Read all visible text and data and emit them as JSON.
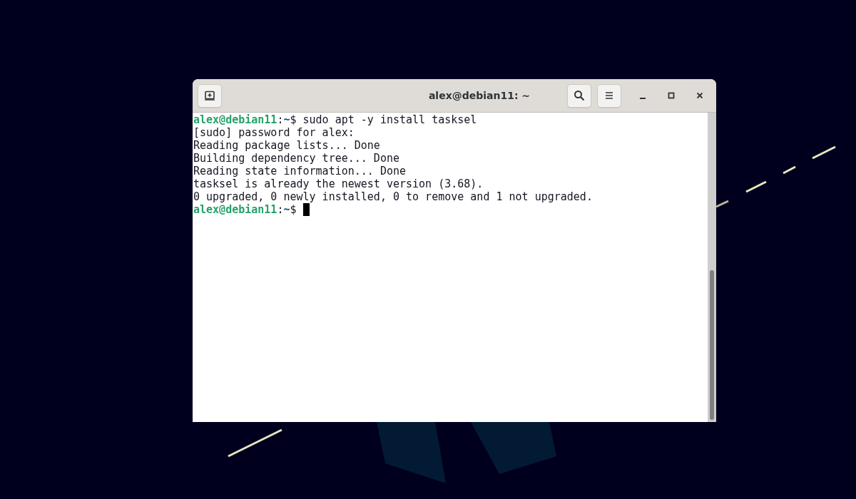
{
  "window": {
    "title": "alex@debian11: ~"
  },
  "terminal": {
    "lines": [
      {
        "kind": "prompt",
        "user_host": "alex@debian11",
        "separator": ":",
        "path": "~",
        "symbol": "$",
        "command": "sudo apt -y install tasksel",
        "cursor": false
      },
      {
        "kind": "output",
        "text": "[sudo] password for alex:"
      },
      {
        "kind": "output",
        "text": "Reading package lists... Done"
      },
      {
        "kind": "output",
        "text": "Building dependency tree... Done"
      },
      {
        "kind": "output",
        "text": "Reading state information... Done"
      },
      {
        "kind": "output",
        "text": "tasksel is already the newest version (3.68)."
      },
      {
        "kind": "output",
        "text": "0 upgraded, 0 newly installed, 0 to remove and 1 not upgraded."
      },
      {
        "kind": "prompt",
        "user_host": "alex@debian11",
        "separator": ":",
        "path": "~",
        "symbol": "$",
        "cursor": true
      }
    ]
  }
}
